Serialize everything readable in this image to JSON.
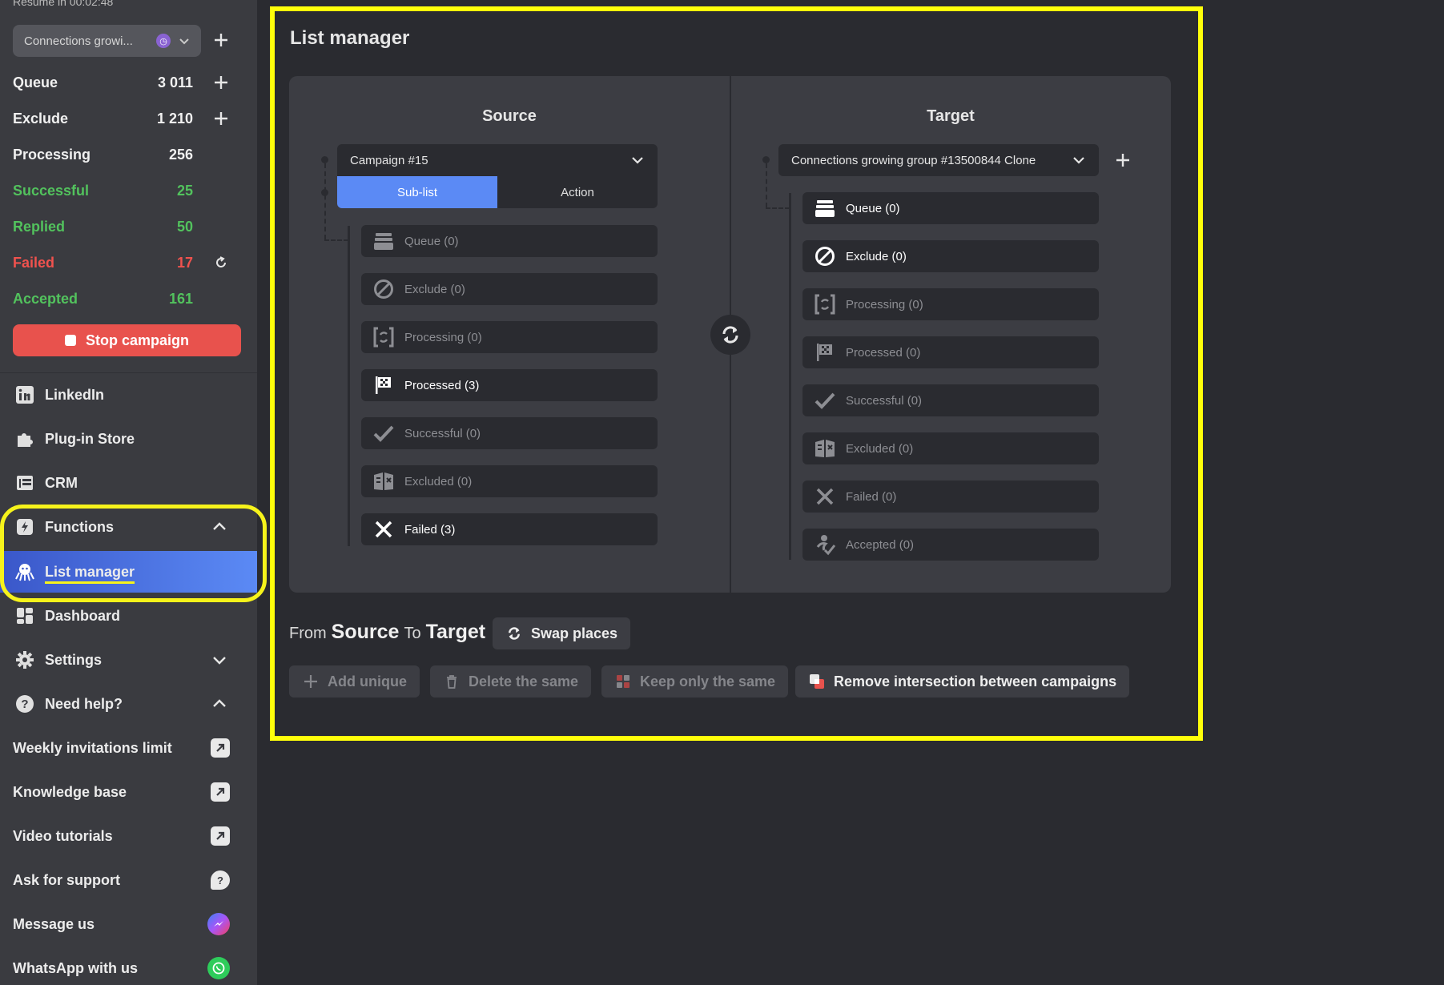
{
  "sidebar": {
    "resume_text": "Resume in 00:02:48",
    "campaign_select": "Connections growi...",
    "stats": [
      {
        "label": "Queue",
        "value": "3 011",
        "color": "white"
      },
      {
        "label": "Exclude",
        "value": "1 210",
        "color": "white"
      },
      {
        "label": "Processing",
        "value": "256",
        "color": "white"
      },
      {
        "label": "Successful",
        "value": "25",
        "color": "green"
      },
      {
        "label": "Replied",
        "value": "50",
        "color": "green"
      },
      {
        "label": "Failed",
        "value": "17",
        "color": "red"
      },
      {
        "label": "Accepted",
        "value": "161",
        "color": "green"
      }
    ],
    "stop_button": "Stop campaign",
    "nav": [
      {
        "label": "LinkedIn",
        "icon": "linkedin-icon"
      },
      {
        "label": "Plug-in Store",
        "icon": "puzzle-icon"
      },
      {
        "label": "CRM",
        "icon": "crm-icon"
      },
      {
        "label": "Functions",
        "icon": "functions-icon"
      },
      {
        "label": "List manager",
        "icon": "octopus-icon"
      },
      {
        "label": "Dashboard",
        "icon": "dashboard-icon"
      },
      {
        "label": "Settings",
        "icon": "gear-icon"
      },
      {
        "label": "Need help?",
        "icon": "question-icon"
      }
    ],
    "help_links": [
      {
        "label": "Weekly invitations limit",
        "icon": "external-link-icon"
      },
      {
        "label": "Knowledge base",
        "icon": "external-link-icon"
      },
      {
        "label": "Video tutorials",
        "icon": "external-link-icon"
      },
      {
        "label": "Ask for support",
        "icon": "question-bubble-icon"
      },
      {
        "label": "Message us",
        "icon": "messenger-icon"
      },
      {
        "label": "WhatsApp with us",
        "icon": "whatsapp-icon"
      }
    ]
  },
  "main": {
    "title": "List manager",
    "source": {
      "heading": "Source",
      "campaign": "Campaign #15",
      "tabs": [
        "Sub-list",
        "Action"
      ],
      "items": [
        {
          "label": "Queue (0)",
          "icon": "stack-icon",
          "active": false
        },
        {
          "label": "Exclude (0)",
          "icon": "ban-icon",
          "active": false
        },
        {
          "label": "Processing (0)",
          "icon": "processing-icon",
          "active": false
        },
        {
          "label": "Processed (3)",
          "icon": "flag-icon",
          "active": true
        },
        {
          "label": "Successful (0)",
          "icon": "check-icon",
          "active": false
        },
        {
          "label": "Excluded (0)",
          "icon": "excluded-icon",
          "active": false
        },
        {
          "label": "Failed (3)",
          "icon": "x-icon",
          "active": true
        }
      ]
    },
    "target": {
      "heading": "Target",
      "campaign": "Connections growing group #13500844 Clone",
      "items": [
        {
          "label": "Queue (0)",
          "icon": "stack-icon",
          "active": true
        },
        {
          "label": "Exclude (0)",
          "icon": "ban-icon",
          "active": true
        },
        {
          "label": "Processing (0)",
          "icon": "processing-icon",
          "active": false
        },
        {
          "label": "Processed (0)",
          "icon": "flag-icon",
          "active": false
        },
        {
          "label": "Successful (0)",
          "icon": "check-icon",
          "active": false
        },
        {
          "label": "Excluded (0)",
          "icon": "excluded-icon",
          "active": false
        },
        {
          "label": "Failed (0)",
          "icon": "x-icon",
          "active": false
        },
        {
          "label": "Accepted (0)",
          "icon": "accepted-icon",
          "active": false
        }
      ]
    },
    "from_to": {
      "from": "From",
      "source": "Source",
      "to": "To",
      "target": "Target"
    },
    "swap_button": "Swap places",
    "actions": [
      {
        "label": "Add unique",
        "icon": "plus-icon",
        "enabled": false
      },
      {
        "label": "Delete the same",
        "icon": "trash-icon",
        "enabled": false
      },
      {
        "label": "Keep only the same",
        "icon": "grid-icon",
        "enabled": false
      },
      {
        "label": "Remove intersection between campaigns",
        "icon": "intersection-icon",
        "enabled": true
      }
    ]
  },
  "colors": {
    "accent_blue": "#5b8af5",
    "stop_red": "#e8524d",
    "green": "#52c25d",
    "highlight_yellow": "#ffff0a"
  }
}
